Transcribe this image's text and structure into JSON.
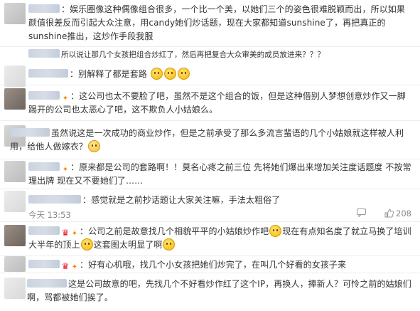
{
  "comments": [
    {
      "text": "：娱乐圈像这种偶像组合很多，一个比一个美，以她们三个的姿色很难脱颖而出，所以如果颜值很差反而引起大众注意，用candy她们炒话题，现在大家都知道sunshine了，再把真正的sunshine推出，这炒作手段我服"
    },
    {
      "text": "所以说让那几个女孩把组合炒红了，然后再把复合大众审美的成员放进来？？？"
    },
    {
      "text": "：别解释了都是套路"
    },
    {
      "text": "：这公司也太不要脸了吧，虽然不是这个组合的饭，但是这种借别人梦想创意炒作又一脚踢开的公司也太恶心了吧，这不欺负人小姑娘么。"
    },
    {
      "text": "虽然说这是一次成功的商业炒作，但是之前承受了那么多流言蜚语的几个小姑娘就这样被人利用，给他人做嫁衣？"
    },
    {
      "text": "：原来都是公司的套路啊！！莫名心疼之前三位  先将她们爆出来增加关注度话题度  不按常理出牌  现在又不要她们了……"
    },
    {
      "text": "：感觉就是之前抄话题让大家关注嘛，手法太粗俗了"
    },
    {
      "text_a": "：公司之前是故意找几个相貌平平的小姑娘炒作吧",
      "text_b": "现在有点知名度了就立马换了培训大半年的顶上",
      "text_c": "这套图太明显了啊"
    },
    {
      "text": "：好有心机哦，找几个小女孩把她们炒完了，在叫几个好看的女孩子来"
    },
    {
      "text": "这是公司故意的吧，先找几个不好看炒作红了这个IP，再换人，捧新人？可怜之前的姑娘们啊，骂都被她们挨了。"
    }
  ],
  "meta": {
    "time": "今天 13:53",
    "likes": "208"
  },
  "icons": {
    "verified": "v-badge-icon",
    "vip": "crown-icon",
    "emoji": "emoji-face-icon",
    "reply": "reply-icon",
    "like": "thumb-up-icon"
  }
}
